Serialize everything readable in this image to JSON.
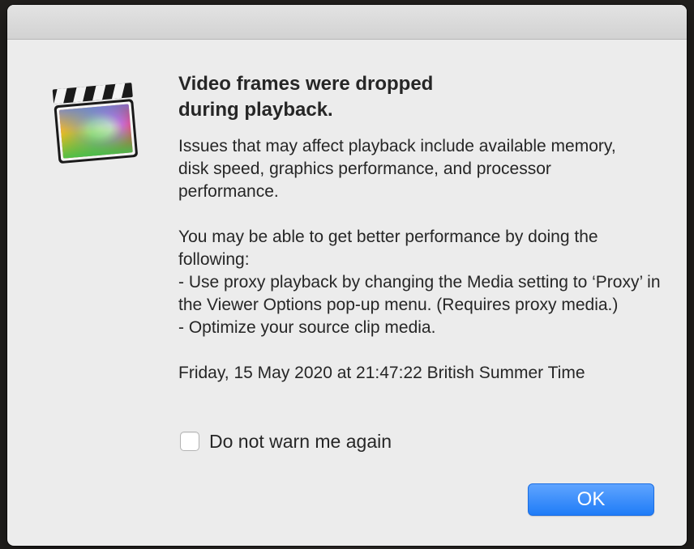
{
  "dialog": {
    "app_icon": "final-cut-pro-clapperboard-icon",
    "headline_line1": "Video frames were dropped",
    "headline_line2": "during playback.",
    "issues_text": "Issues that may affect playback include available memory, disk speed, graphics performance, and processor performance.",
    "suggestion_intro": "You may be able to get better performance by doing the following:",
    "tip_proxy": "- Use proxy playback by changing the Media setting to ‘Proxy’ in the Viewer Options pop-up menu. (Requires proxy media.)",
    "tip_optimize": "- Optimize your source clip media.",
    "timestamp": "Friday, 15 May 2020 at 21:47:22 British Summer Time",
    "checkbox": {
      "label": "Do not warn me again",
      "checked": false
    },
    "ok_button_label": "OK"
  },
  "colors": {
    "dialog_background": "#ececec",
    "ok_button_blue": "#1f7cf7",
    "text": "#262626"
  }
}
